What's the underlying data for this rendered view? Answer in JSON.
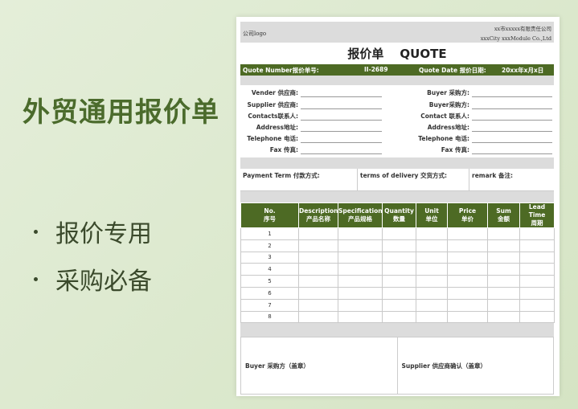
{
  "promo": {
    "title": "外贸通用报价单",
    "bullets": [
      "报价专用",
      "采购必备"
    ]
  },
  "sheet": {
    "logo": "公司logo",
    "company_cn": "xx市xxxxx有限责任公司",
    "company_en": "xxxCity xxxModule Co.,Ltd",
    "title_cn": "报价单",
    "title_en": "QUOTE",
    "quote_number_label": "Quote Number报价单号:",
    "quote_number": "II-2689",
    "quote_date_label": "Quote Date  报价日期:",
    "quote_date": "20xx年x月x日",
    "left_fields": [
      "Vender 供应商:",
      "Supplier 供应商:",
      "Contacts联系人:",
      "Address地址:",
      "Telephone 电话:",
      "Fax 传真:"
    ],
    "right_fields": [
      "Buyer 采购方:",
      "Buyer采购方:",
      "Contact 联系人:",
      "Address地址:",
      "Telephone 电话:",
      "Fax 传真:"
    ],
    "terms": [
      "Payment Term 付款方式:",
      "terms of delivery 交货方式:",
      "remark 备注:"
    ],
    "columns": [
      {
        "en": "No.",
        "cn": "序号"
      },
      {
        "en": "Description",
        "cn": "产品名称"
      },
      {
        "en": "Specification",
        "cn": "产品规格"
      },
      {
        "en": "Quantity",
        "cn": "数量"
      },
      {
        "en": "Unit",
        "cn": "单位"
      },
      {
        "en": "Price",
        "cn": "单价"
      },
      {
        "en": "Sum",
        "cn": "金额"
      },
      {
        "en": "Lead Time",
        "cn": "周期"
      }
    ],
    "rows": [
      "1",
      "2",
      "3",
      "4",
      "5",
      "6",
      "7",
      "8"
    ],
    "sign_buyer": "Buyer 采购方（盖章）",
    "sign_supplier": "Supplier 供应商确认（盖章）"
  }
}
